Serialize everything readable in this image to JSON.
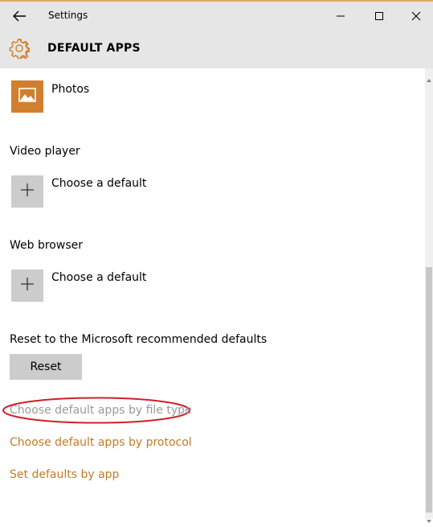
{
  "window": {
    "title": "Settings",
    "header_title": "DEFAULT APPS"
  },
  "photo_viewer": {
    "app_name": "Photos",
    "tile_color": "#d07f2e",
    "icon": "photos-icon"
  },
  "video_player": {
    "label": "Video player",
    "choice": "Choose a default",
    "icon": "plus-icon"
  },
  "web_browser": {
    "label": "Web browser",
    "choice": "Choose a default",
    "icon": "plus-icon"
  },
  "reset": {
    "label": "Reset to the Microsoft recommended defaults",
    "button": "Reset"
  },
  "links": {
    "file_type": "Choose default apps by file type",
    "protocol": "Choose default apps by protocol",
    "by_app": "Set defaults by app"
  },
  "colors": {
    "accent": "#c27c25",
    "annotation_circle": "#d0202a",
    "chrome": "#e6e6e6"
  }
}
